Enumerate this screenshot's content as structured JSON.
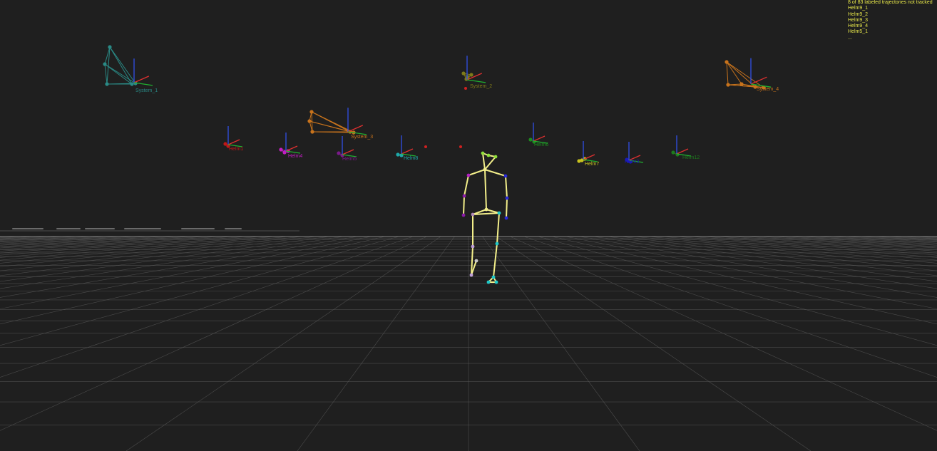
{
  "status": {
    "header": "8 of 83 labeled trajectories not tracked",
    "items": [
      "Helm9_1",
      "Helm9_2",
      "Helm9_3",
      "Helm9_4",
      "Helm5_1"
    ],
    "more": "..."
  },
  "rigid_bodies": [
    {
      "name": "System_1",
      "color": "#2a8a86"
    },
    {
      "name": "System_2",
      "color": "#7e7a1a"
    },
    {
      "name": "System_3",
      "color": "#c8731c"
    },
    {
      "name": "System_4",
      "color": "#c8731c"
    },
    {
      "name": "Helm1",
      "color": "#c01818"
    },
    {
      "name": "Helm4",
      "color": "#c21ec2"
    },
    {
      "name": "Helm5",
      "color": "#7a1a8a"
    },
    {
      "name": "Helm8",
      "color": "#1ea8a8"
    },
    {
      "name": "Helm6",
      "color": "#1e8a1e"
    },
    {
      "name": "Helm7",
      "color": "#c8c21e"
    },
    {
      "name": "Helm3",
      "color": "#1a1ab8"
    },
    {
      "name": "Helm12",
      "color": "#1e7a1e"
    }
  ],
  "skeleton": {
    "name": "skeleton",
    "bone_color": "#f3ef8a"
  },
  "colors": {
    "background": "#1f1f1f",
    "grid": "#5a5a5a",
    "horizon": "#8a8a8a",
    "status_text": "#e8e84a",
    "axis_x": "#e03030",
    "axis_y": "#20b030",
    "axis_z": "#3050e8"
  }
}
